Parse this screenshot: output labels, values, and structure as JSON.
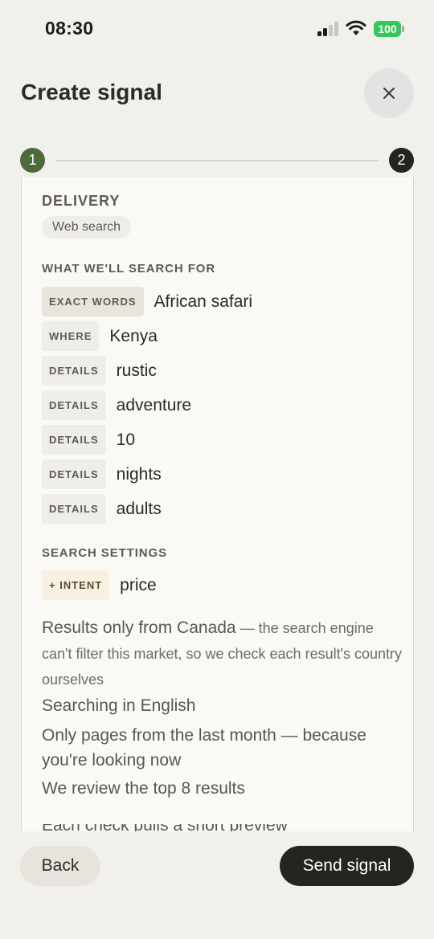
{
  "status_bar": {
    "time": "08:30",
    "battery": "100",
    "icons": [
      "cellular-signal-icon",
      "wifi-icon",
      "battery-icon"
    ]
  },
  "header": {
    "title": "Create signal",
    "close_icon": "close-icon"
  },
  "stepper": {
    "steps": [
      "1",
      "2"
    ],
    "current": 1,
    "colors": {
      "done": "#4c6b3c",
      "pending": "#252421"
    }
  },
  "delivery": {
    "heading": "DELIVERY",
    "method": "Web search"
  },
  "search_for": {
    "heading": "WHAT WE'LL SEARCH FOR",
    "terms": [
      {
        "tag": "EXACT WORDS",
        "value": "African safari"
      },
      {
        "tag": "WHERE",
        "value": "Kenya"
      },
      {
        "tag": "DETAILS",
        "value": "rustic"
      },
      {
        "tag": "DETAILS",
        "value": "adventure"
      },
      {
        "tag": "DETAILS",
        "value": "10"
      },
      {
        "tag": "DETAILS",
        "value": "nights"
      },
      {
        "tag": "DETAILS",
        "value": "adults"
      }
    ]
  },
  "settings": {
    "heading": "SEARCH SETTINGS",
    "intent_tag": "+ INTENT",
    "intent_value": "price",
    "region_main": "Results only from Canada",
    "region_note": " — the search engine can't filter this market, so we check each result's country ourselves",
    "language": "Searching in English",
    "recency": "Only pages from the last month — because you're looking now",
    "review": "We review the top 8 results",
    "partial_line": "Each check pulls a short preview"
  },
  "footer": {
    "back_label": "Back",
    "send_label": "Send signal"
  }
}
